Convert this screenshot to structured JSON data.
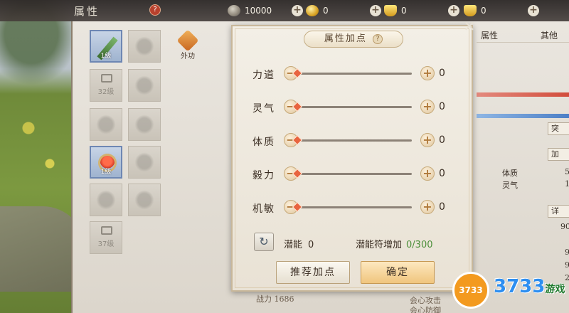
{
  "header": {
    "title": "属性",
    "help": "?",
    "currencies": [
      {
        "icon": "silver-coin-icon",
        "value": "10000"
      },
      {
        "icon": "gold-coin-icon",
        "value": "0"
      },
      {
        "icon": "gold-ingot-icon",
        "value": "0"
      },
      {
        "icon": "ingot-icon",
        "value": "0"
      }
    ],
    "plus": "+"
  },
  "equipment": {
    "weapon_level": "1级",
    "ring_level": "1级",
    "locked_level_1": "32级",
    "locked_level_2": "37级",
    "skill_label": "外功"
  },
  "right_panel": {
    "tab_attr": "属性",
    "tab_other": "其他",
    "breakthrough_btn": "突",
    "add_point_btn": "加",
    "row_physique": "体质",
    "row_spirit": "灵气",
    "detail_btn": "详",
    "num_a": "5",
    "num_b": "1",
    "num_c": "90",
    "num_d": "9",
    "num_e": "9",
    "num_f": "2"
  },
  "bottom": {
    "power": "战力 1686",
    "extra_1": "会心攻击",
    "extra_2": "会心防御"
  },
  "dialog": {
    "title": "属性加点",
    "help": "?",
    "close": "✕",
    "minus": "−",
    "plus": "+",
    "attributes": [
      {
        "label": "力道",
        "value": "0",
        "level": 0
      },
      {
        "label": "灵气",
        "value": "0",
        "level": 0
      },
      {
        "label": "体质",
        "value": "0",
        "level": 0
      },
      {
        "label": "毅力",
        "value": "0",
        "level": 0
      },
      {
        "label": "机敏",
        "value": "0",
        "level": 0
      }
    ],
    "refresh_icon": "↻",
    "potential_label": "潜能",
    "potential_value": "0",
    "potential_add_label": "潜能符增加",
    "potential_add_value": "0/300",
    "recommend_btn": "推荐加点",
    "confirm_btn": "确定"
  },
  "watermark": {
    "badge": "3733",
    "text": "3733",
    "cn": "游戏"
  }
}
